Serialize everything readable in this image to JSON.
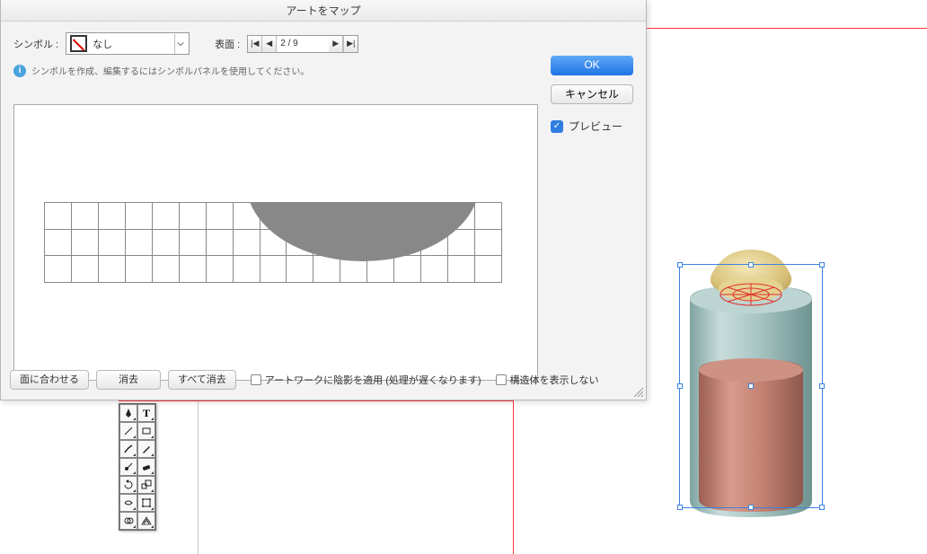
{
  "dialog": {
    "title": "アートをマップ",
    "symbol_label": "シンボル :",
    "symbol_value": "なし",
    "surface_label": "表面 :",
    "surface_value": "2 / 9",
    "info_text": "シンボルを作成、編集するにはシンボルパネルを使用してください。",
    "ok_label": "OK",
    "cancel_label": "キャンセル",
    "preview_label": "プレビュー",
    "preview_checked": true,
    "fit_label": "面に合わせる",
    "clear_label": "消去",
    "clear_all_label": "すべて消去",
    "shade_label": "アートワークに陰影を適用 (処理が遅くなります)",
    "hide_geo_label": "構造体を表示しない",
    "shade_checked": false,
    "hide_geo_checked": false
  },
  "colors": {
    "jar_body": "#a9c6c4",
    "jar_inner": "#c38273",
    "jar_cap": "#dcc583",
    "wire": "#e03030"
  }
}
